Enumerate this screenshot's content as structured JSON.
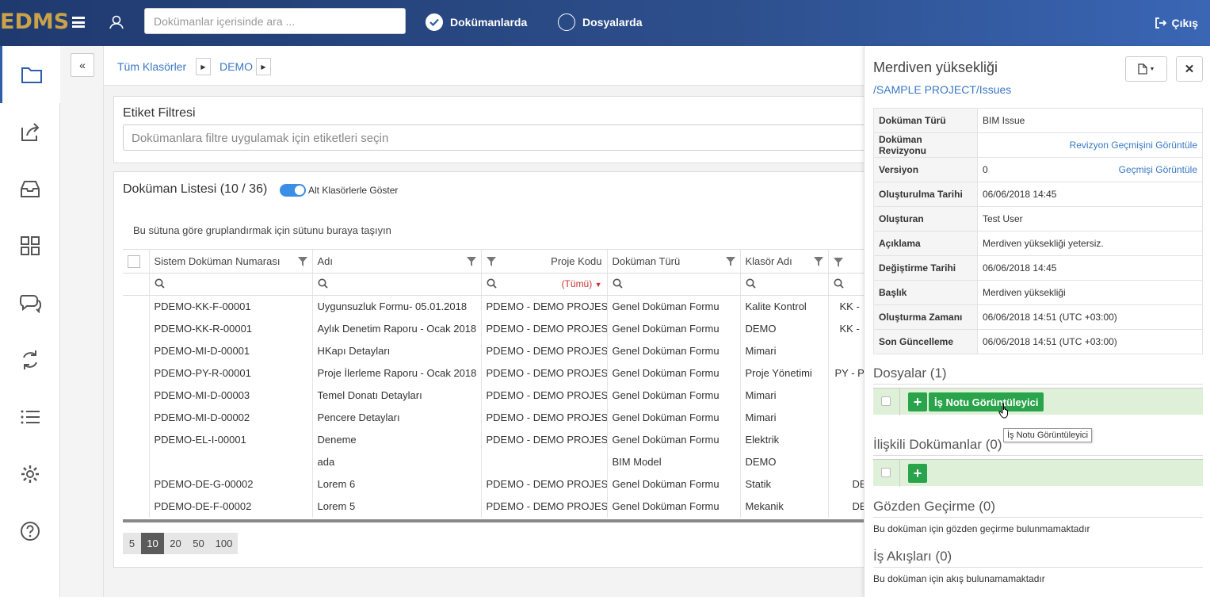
{
  "app": {
    "logo": "EDMS"
  },
  "topbar": {
    "search_placeholder": "Dokümanlar içerisinde ara ...",
    "radio_documents": "Dokümanlarda",
    "radio_files": "Dosyalarda",
    "logout": "Çıkış"
  },
  "breadcrumb": {
    "items": [
      "Tüm Klasörler",
      "DEMO"
    ]
  },
  "tag_filter": {
    "title": "Etiket Filtresi",
    "placeholder": "Dokümanlara filtre uygulamak için etiketleri seçin"
  },
  "doc_list": {
    "title": "Doküman Listesi (10 / 36)",
    "toggle_label": "Alt Klasörlerle Göster",
    "group_hint": "Bu sütuna göre gruplandırmak için sütunu buraya taşıyın",
    "columns": [
      "Sistem Doküman Numarası",
      "Adı",
      "Proje Kodu",
      "Doküman Türü",
      "Klasör Adı",
      ""
    ],
    "project_filter_value": "(Tümü)",
    "rows": [
      [
        "PDEMO-KK-F-00001",
        "Uygunsuzluk Formu- 05.01.2018",
        "PDEMO - DEMO PROJESİ",
        "Genel Doküman Formu",
        "Kalite Kontrol",
        "KK - "
      ],
      [
        "PDEMO-KK-R-00001",
        "Aylık Denetim Raporu - Ocak 2018",
        "PDEMO - DEMO PROJESİ",
        "Genel Doküman Formu",
        "DEMO",
        "KK - "
      ],
      [
        "PDEMO-MI-D-00001",
        "HKapı Detayları",
        "PDEMO - DEMO PROJESİ",
        "Genel Doküman Formu",
        "Mimari",
        ""
      ],
      [
        "PDEMO-PY-R-00001",
        "Proje İlerleme Raporu - Ocak 2018",
        "PDEMO - DEMO PROJESİ",
        "Genel Doküman Formu",
        "Proje Yönetimi",
        "PY - P"
      ],
      [
        "PDEMO-MI-D-00003",
        "Temel Donatı Detayları",
        "PDEMO - DEMO PROJESİ",
        "Genel Doküman Formu",
        "Mimari",
        ""
      ],
      [
        "PDEMO-MI-D-00002",
        "Pencere Detayları",
        "PDEMO - DEMO PROJESİ",
        "Genel Doküman Formu",
        "Mimari",
        ""
      ],
      [
        "PDEMO-EL-I-00001",
        "Deneme",
        "PDEMO - DEMO PROJESİ",
        "Genel Doküman Formu",
        "Elektrik",
        ""
      ],
      [
        "",
        "ada",
        "",
        "BIM Model",
        "DEMO",
        ""
      ],
      [
        "PDEMO-DE-G-00002",
        "Lorem 6",
        "PDEMO - DEMO PROJESİ",
        "Genel Doküman Formu",
        "Statik",
        "DE"
      ],
      [
        "PDEMO-DE-F-00002",
        "Lorem 5",
        "PDEMO - DEMO PROJESİ",
        "Genel Doküman Formu",
        "Mekanik",
        "DE"
      ]
    ],
    "page_sizes": [
      "5",
      "10",
      "20",
      "50",
      "100"
    ],
    "selected_page_size": "10"
  },
  "detail": {
    "title": "Merdiven yüksekliği",
    "path": "/SAMPLE PROJECT/Issues",
    "props": [
      {
        "k": "Doküman Türü",
        "v": "BIM Issue",
        "link": ""
      },
      {
        "k": "Doküman Revizyonu",
        "v": "",
        "link": "Revizyon Geçmişini Görüntüle"
      },
      {
        "k": "Versiyon",
        "v": "0",
        "link": "Geçmişi Görüntüle"
      },
      {
        "k": "Oluşturulma Tarihi",
        "v": "06/06/2018 14:45",
        "link": ""
      },
      {
        "k": "Oluşturan",
        "v": "Test User",
        "link": ""
      },
      {
        "k": "Açıklama",
        "v": "Merdiven yüksekliği yetersiz.",
        "link": ""
      },
      {
        "k": "Değiştirme Tarihi",
        "v": "06/06/2018 14:45",
        "link": ""
      },
      {
        "k": "Başlık",
        "v": "Merdiven yüksekliği",
        "link": ""
      },
      {
        "k": "Oluşturma Zamanı",
        "v": "06/06/2018 14:51 (UTC +03:00)",
        "link": ""
      },
      {
        "k": "Son Güncelleme",
        "v": "06/06/2018 14:51 (UTC +03:00)",
        "link": ""
      }
    ],
    "files_title": "Dosyalar (1)",
    "file_button": "İş Notu Görüntüleyici",
    "tooltip": "İş Notu Görüntüleyici",
    "related_title": "İlişkili Dokümanlar (0)",
    "review_title": "Gözden Geçirme (0)",
    "review_empty": "Bu doküman için gözden geçirme bulunmamaktadır",
    "workflow_title": "İş Akışları (0)",
    "workflow_empty": "Bu doküman için akış bulunamamaktadır"
  }
}
